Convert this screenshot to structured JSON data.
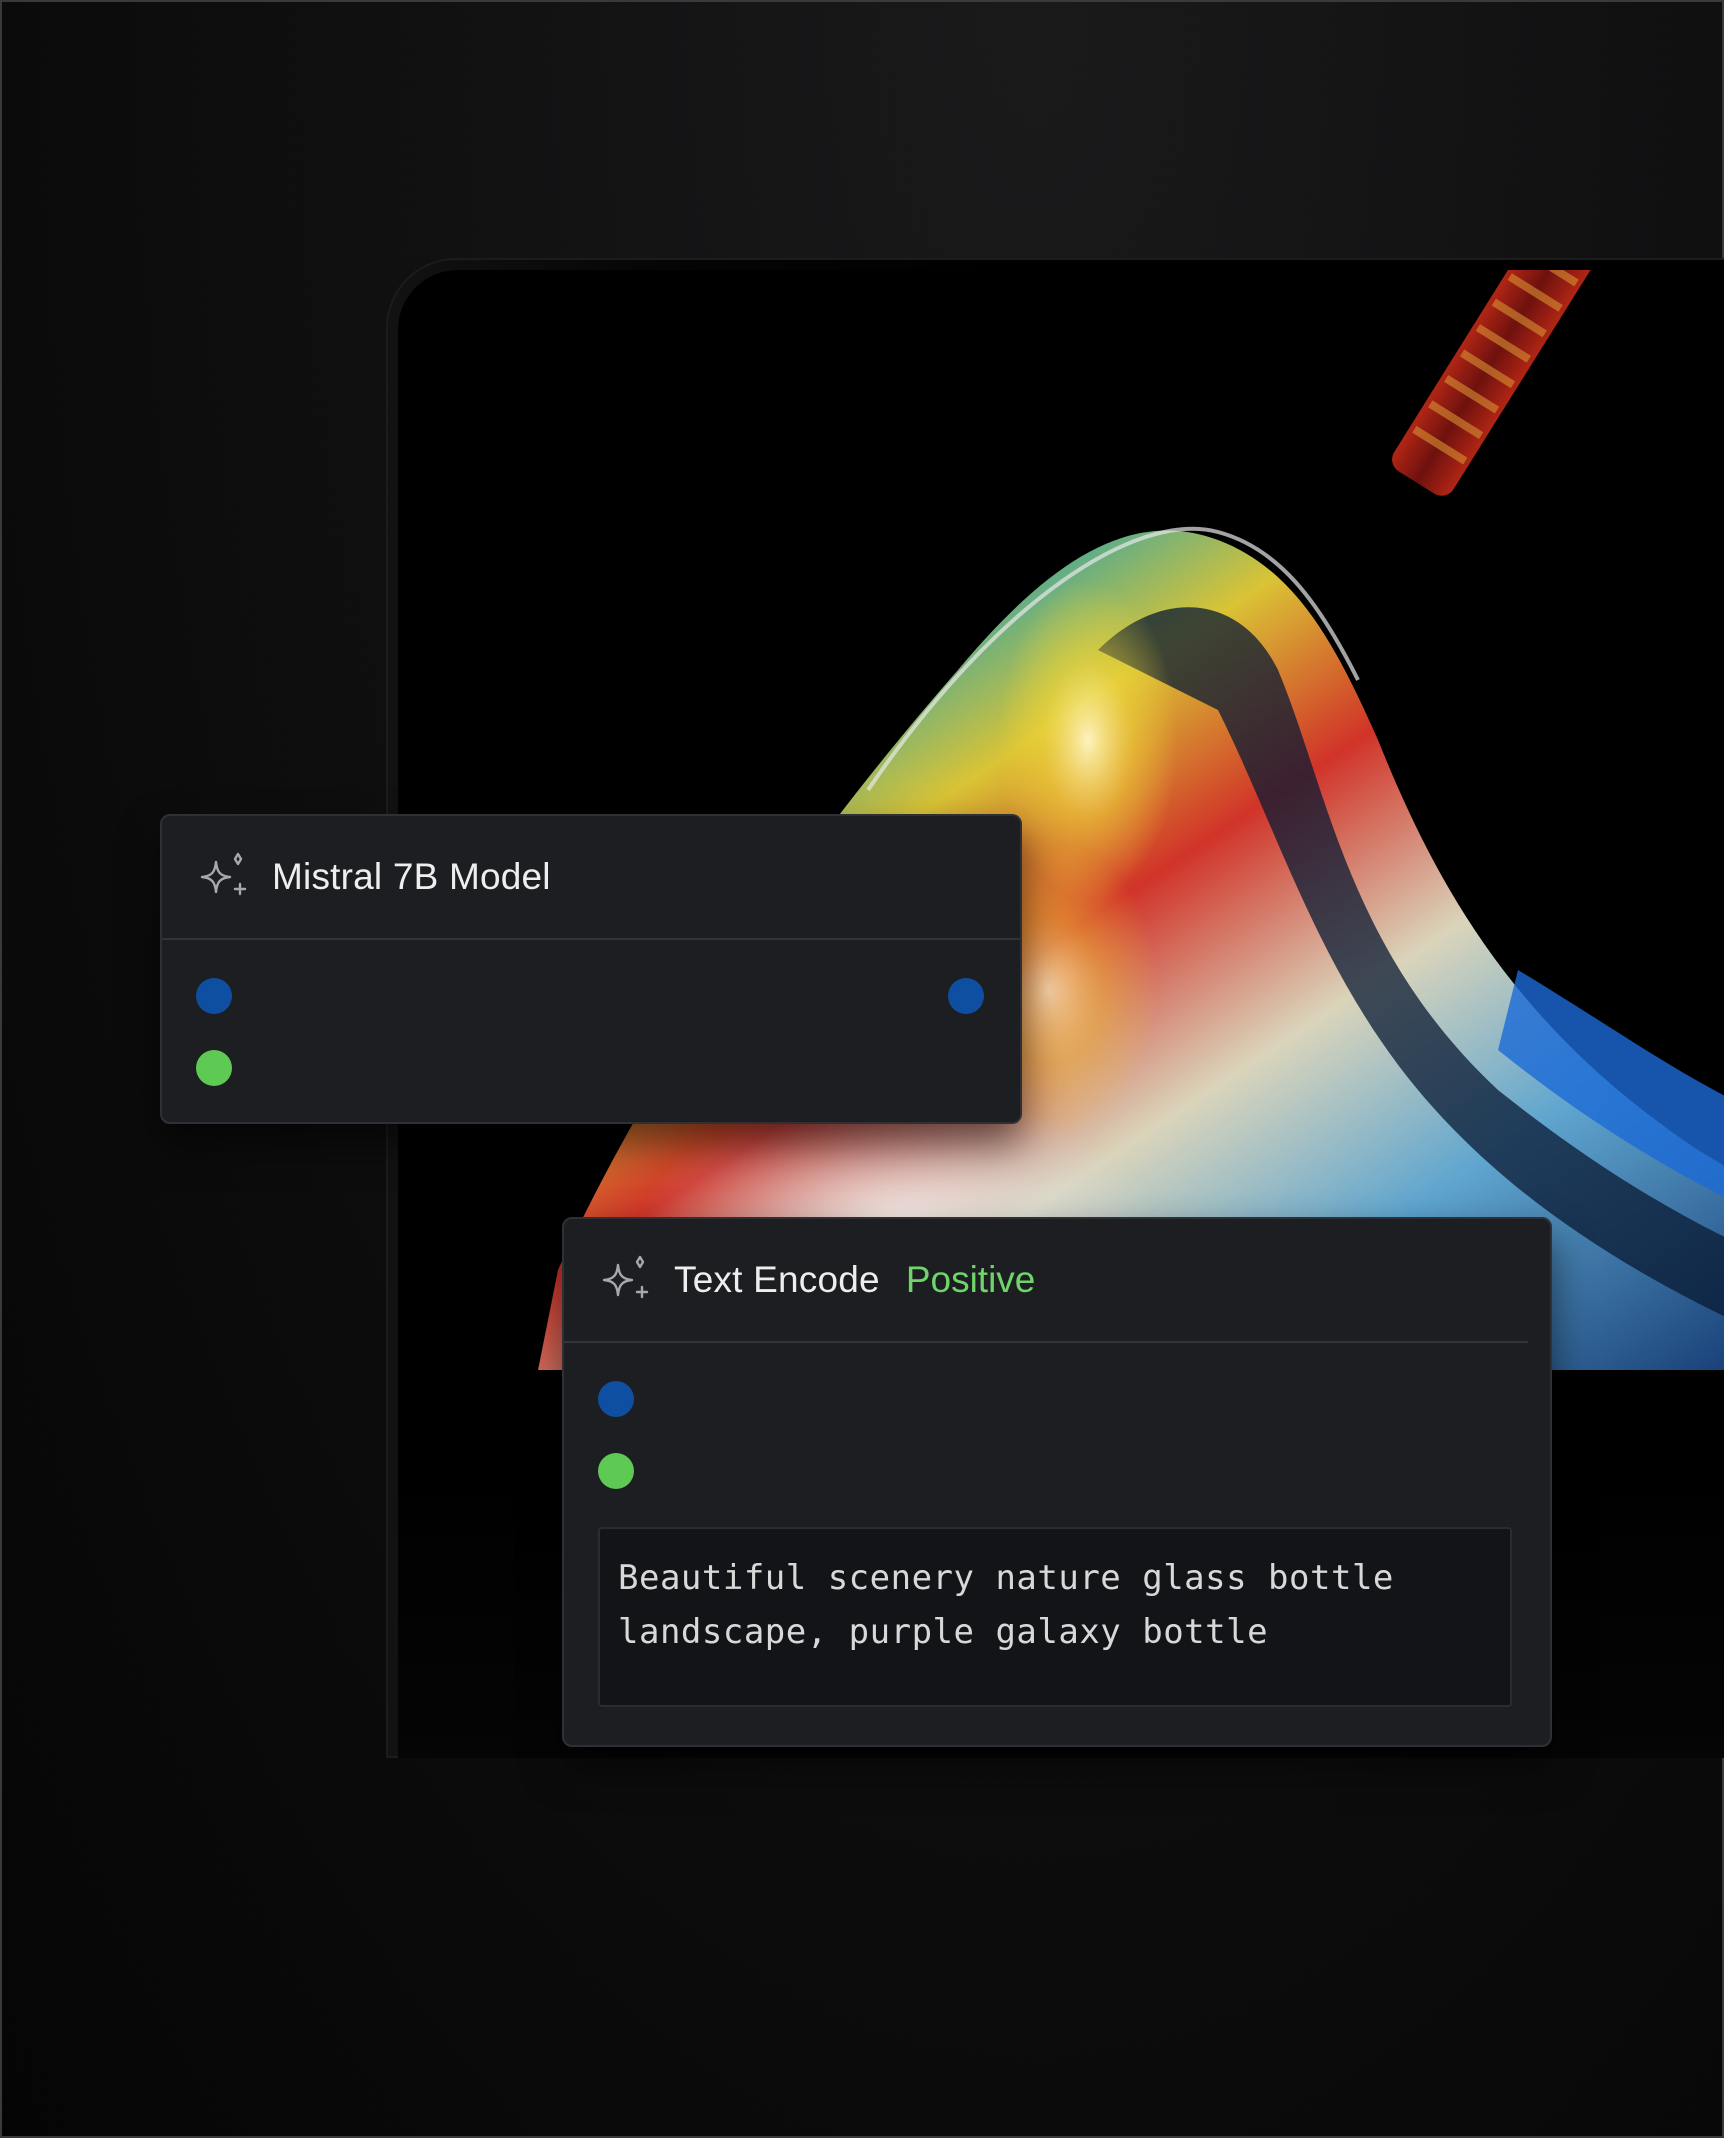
{
  "nodes": {
    "model": {
      "title": "Mistral 7B Model",
      "icon": "sparkles-icon"
    },
    "encode": {
      "title": "Text Encode",
      "tag": "Positive",
      "icon": "sparkles-icon",
      "prompt": "Beautiful scenery nature glass bottle landscape, purple galaxy bottle"
    }
  },
  "colors": {
    "port_blue": "#0f4fa1",
    "port_green": "#5ec953",
    "tag_green": "#6fd469",
    "node_bg": "#1d1e22"
  }
}
